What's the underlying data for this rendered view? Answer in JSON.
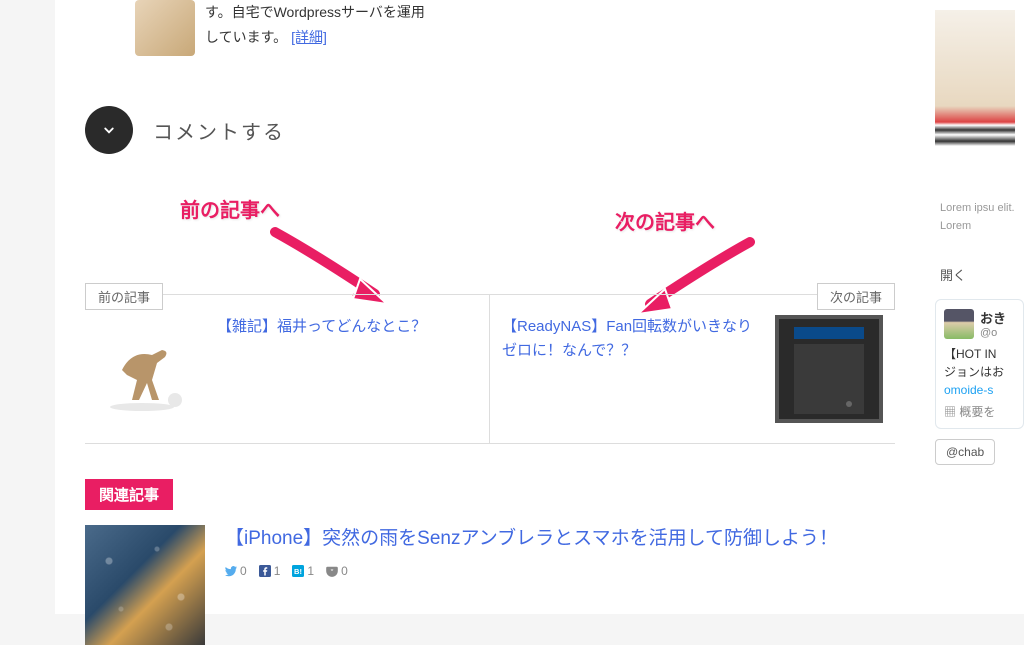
{
  "author": {
    "bio_line1": "す。自宅でWordpressサーバを運用",
    "bio_line2": "しています。 ",
    "detail_label": "[詳細]"
  },
  "comment": {
    "title": "コメントする"
  },
  "annotations": {
    "prev_label": "前の記事へ",
    "next_label": "次の記事へ"
  },
  "nav": {
    "prev_badge": "前の記事",
    "next_badge": "次の記事",
    "prev_title": "【雑記】福井ってどんなとこ？",
    "next_title": "【ReadyNAS】Fan回転数がいきなりゼロに！なんで？？"
  },
  "related": {
    "badge": "関連記事",
    "items": [
      {
        "title": "【iPhone】突然の雨をSenzアンブレラとスマホを活用して防御しよう！",
        "stats": {
          "twitter": "0",
          "facebook": "1",
          "hatena": "1",
          "pocket": "0"
        }
      }
    ]
  },
  "sidebar": {
    "lorem": "Lorem ipsu elit. Lorem",
    "open_label": "開く",
    "tweet": {
      "name": "おき",
      "handle": "@o",
      "body_line1": "【HOT IN",
      "body_line2": "ジョンはお",
      "link": "omoide-s",
      "summary_prefix": "概要を"
    },
    "follow_handle": "@chab"
  }
}
